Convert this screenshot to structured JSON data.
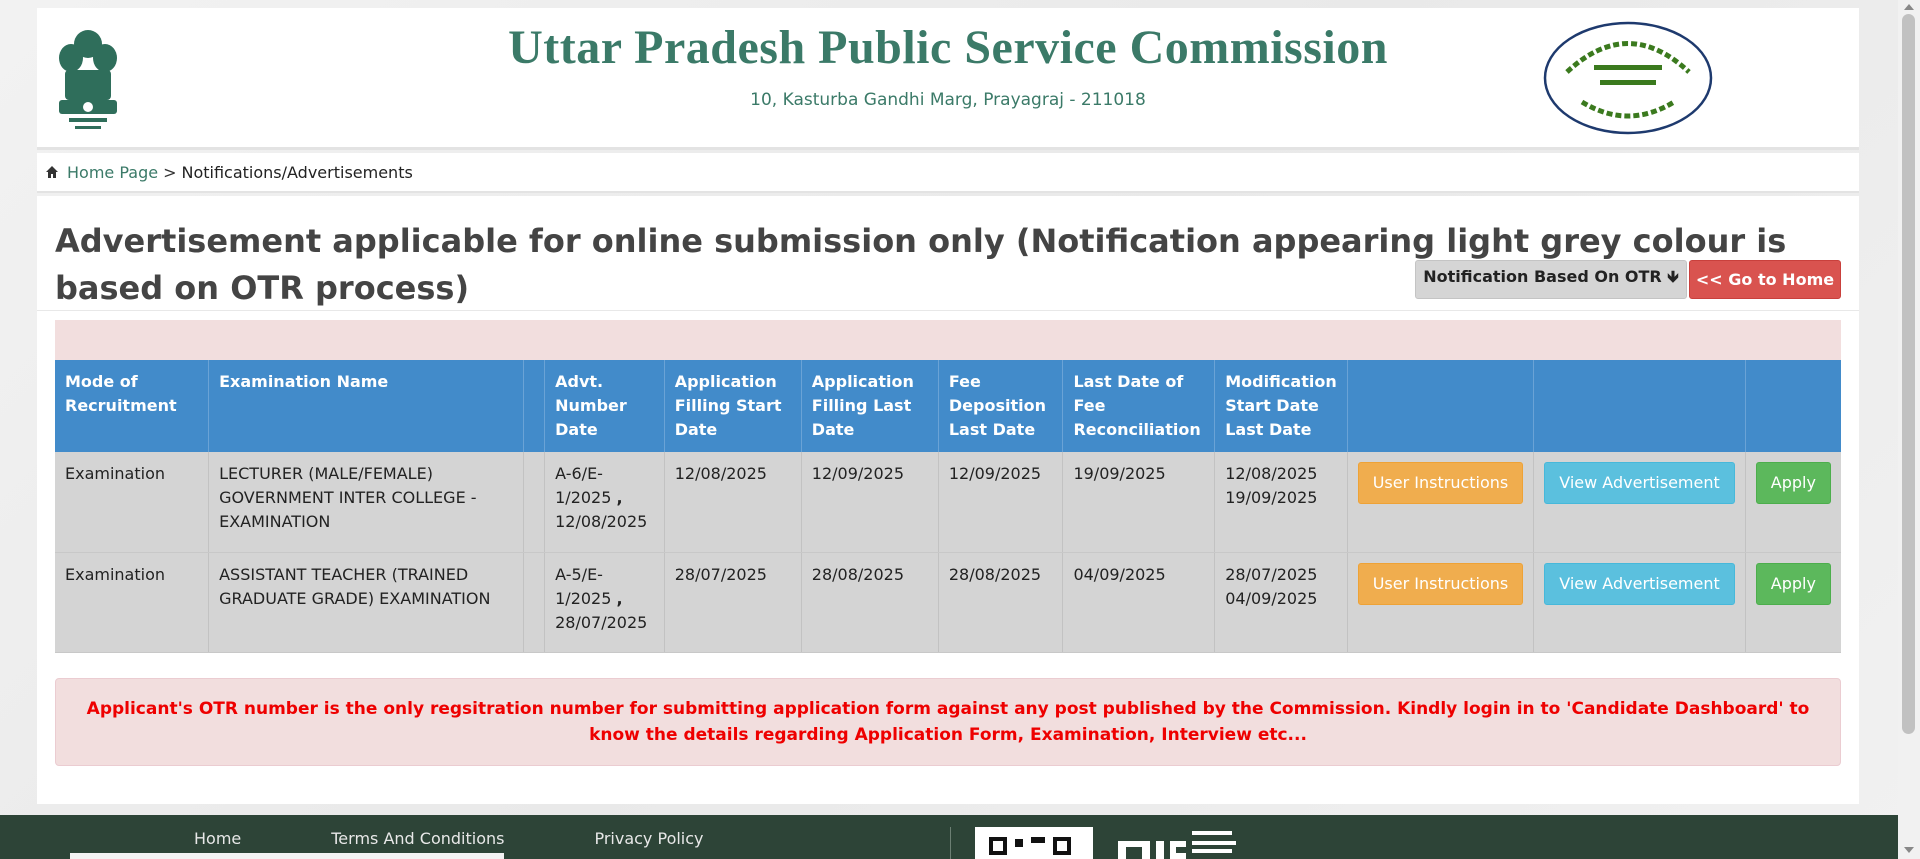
{
  "header": {
    "title": "Uttar Pradesh Public Service Commission",
    "address": "10, Kasturba Gandhi Marg, Prayagraj - 211018"
  },
  "breadcrumb": {
    "home": "Home Page",
    "separator": ">",
    "current": "Notifications/Advertisements"
  },
  "main": {
    "heading": "Advertisement applicable for online submission only (Notification appearing light grey colour is based on OTR process)",
    "otr_button": "Notification Based On OTR 🡻",
    "home_button": "<< Go to Home"
  },
  "table": {
    "headers": [
      "Mode of Recruitment",
      "Examination Name",
      "",
      "Advt. Number Date",
      "Application Filling Start Date",
      "Application Filling Last Date",
      "Fee Deposition Last Date",
      "Last Date of Fee Reconciliation",
      "Modification Start Date Last Date",
      "",
      "",
      ""
    ],
    "rows": [
      {
        "mode": "Examination",
        "exam": "LECTURER (MALE/FEMALE) GOVERNMENT INTER COLLEGE - EXAMINATION",
        "advt_number": "A-6/E-1/2025",
        "advt_sep": ",",
        "advt_date": "12/08/2025",
        "start": "12/08/2025",
        "last": "12/09/2025",
        "fee_last": "12/09/2025",
        "reconciliation": "19/09/2025",
        "mod_start": "12/08/2025",
        "mod_last": "19/09/2025",
        "instructions": "User Instructions",
        "view": "View Advertisement",
        "apply": "Apply"
      },
      {
        "mode": "Examination",
        "exam": "ASSISTANT TEACHER (TRAINED GRADUATE GRADE) EXAMINATION",
        "advt_number": "A-5/E-1/2025",
        "advt_sep": ",",
        "advt_date": "28/07/2025",
        "start": "28/07/2025",
        "last": "28/08/2025",
        "fee_last": "28/08/2025",
        "reconciliation": "04/09/2025",
        "mod_start": "28/07/2025",
        "mod_last": "04/09/2025",
        "instructions": "User Instructions",
        "view": "View Advertisement",
        "apply": "Apply"
      }
    ]
  },
  "notice": "Applicant's OTR number is the only regsitration number for submitting application form against any post published by the Commission. Kindly login in to 'Candidate Dashboard' to know the details regarding Application Form, Examination, Interview etc...",
  "footer": {
    "links": [
      "Home",
      "Terms And Conditions",
      "Privacy Policy"
    ]
  },
  "colors": {
    "brand_green": "#3b7a68",
    "table_header": "#428bca",
    "danger": "#d9534f",
    "warning": "#f0ad4e",
    "info": "#5bc0de",
    "success": "#5cb85c"
  }
}
